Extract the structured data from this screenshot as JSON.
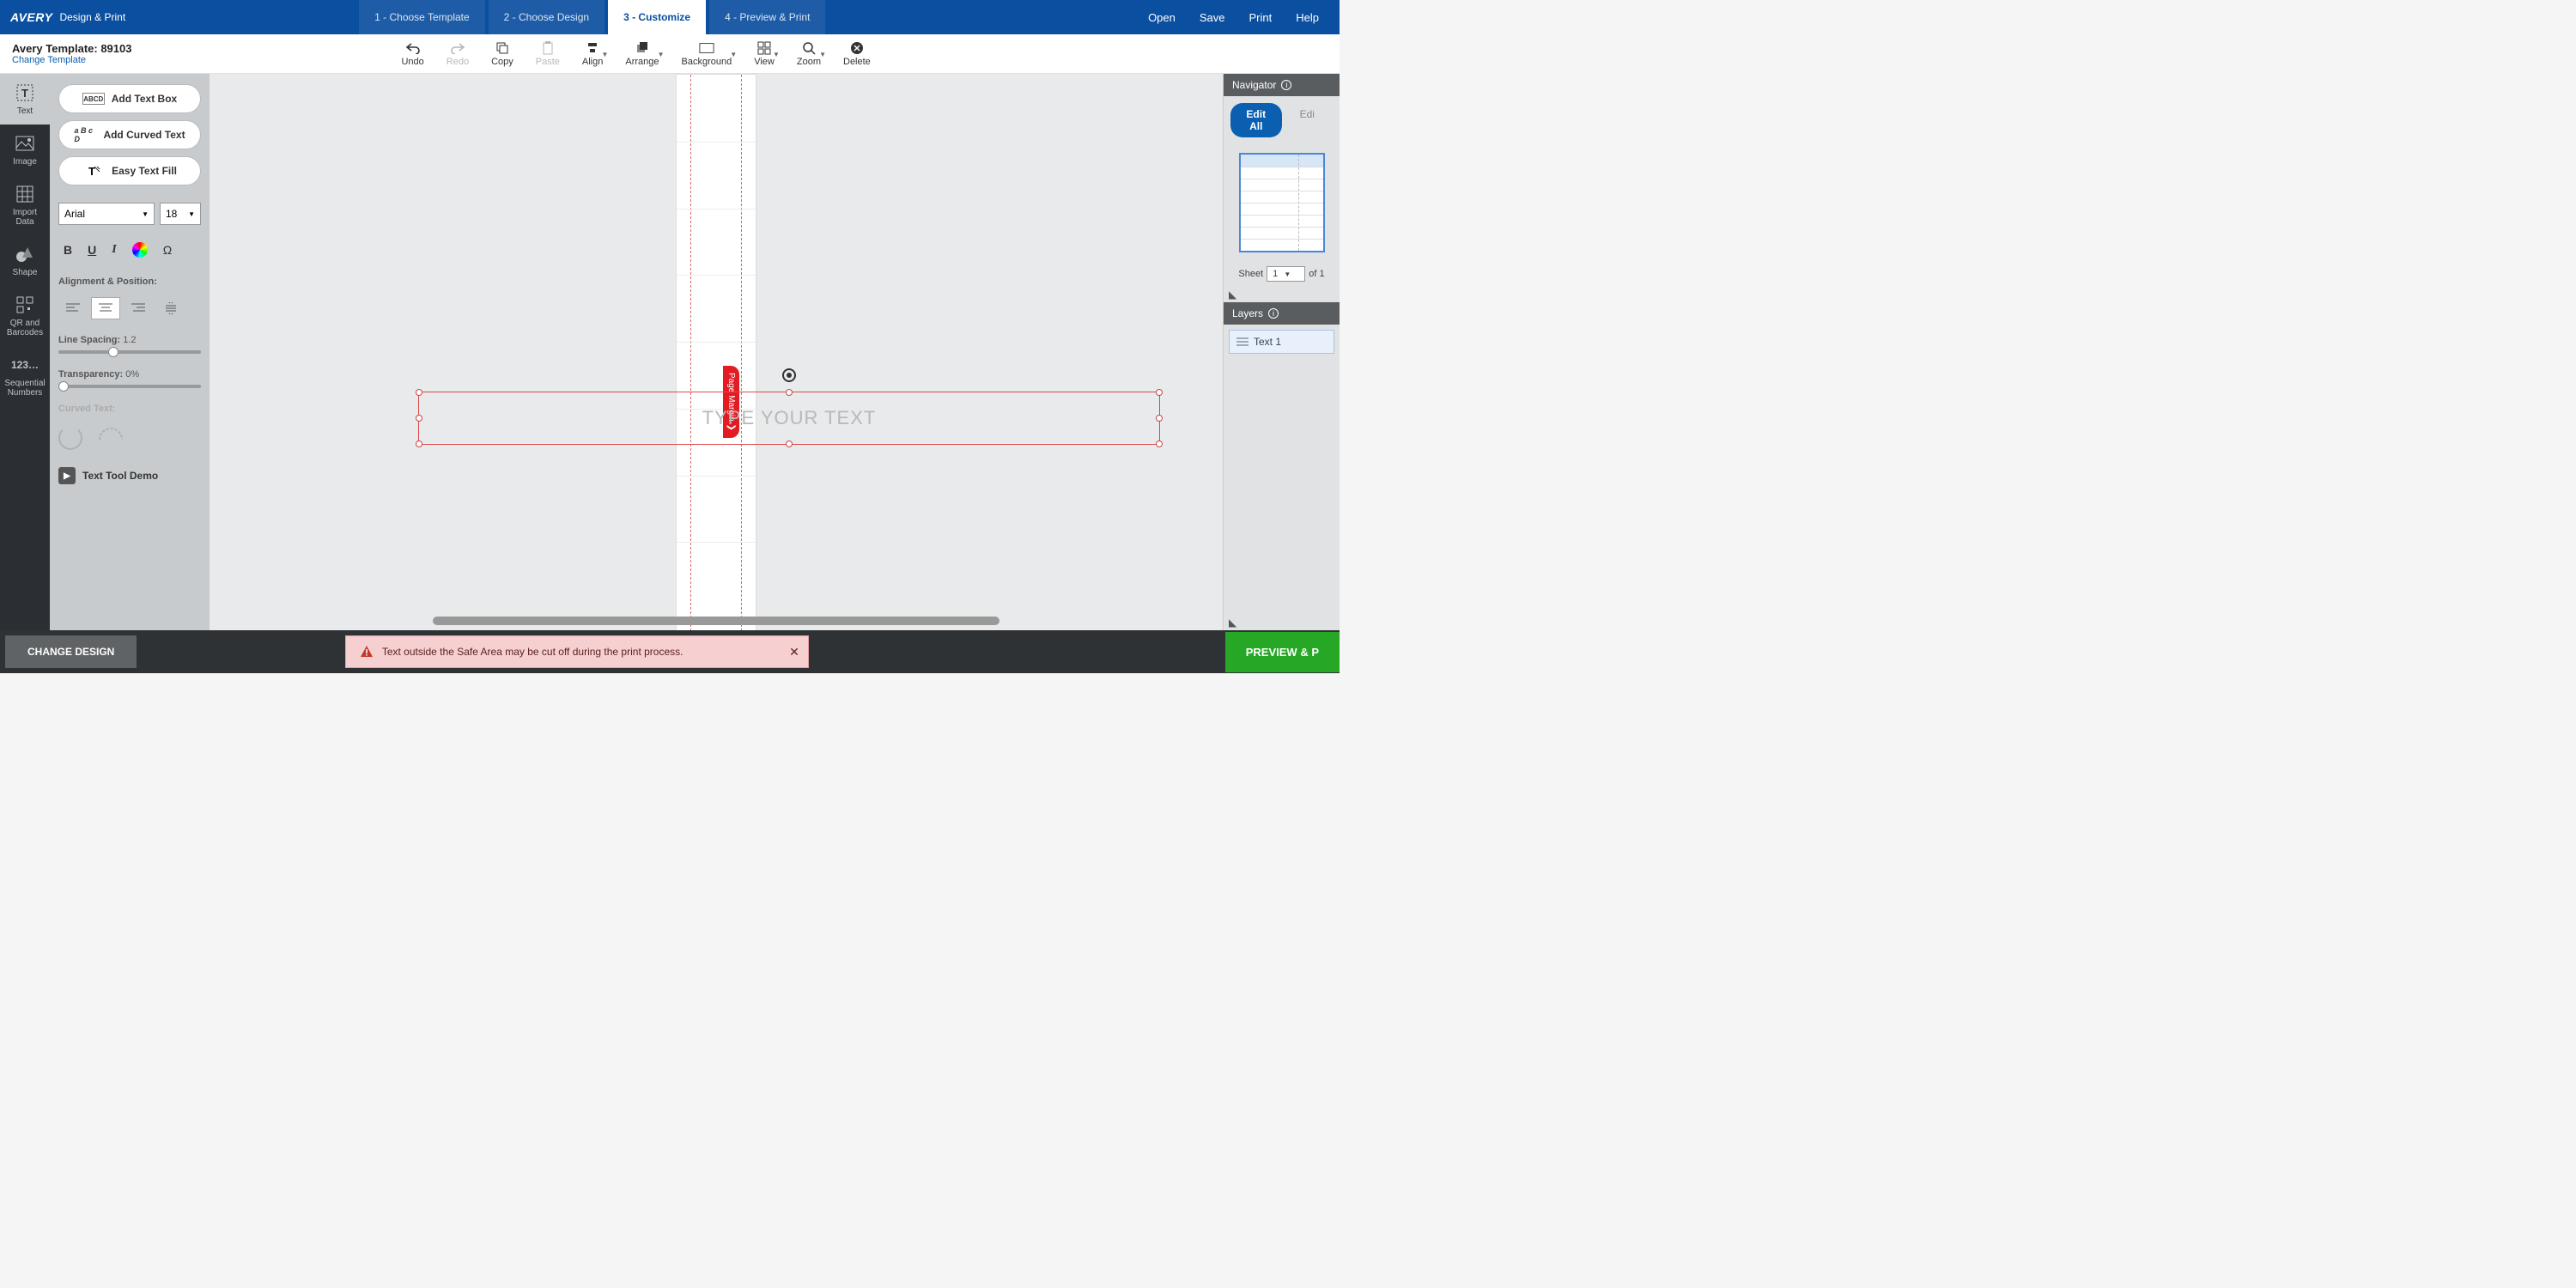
{
  "header": {
    "brand": "AVERY",
    "product": "Design & Print",
    "steps": [
      "1 - Choose Template",
      "2 - Choose Design",
      "3 - Customize",
      "4 - Preview & Print"
    ],
    "active_step": 2,
    "links": {
      "open": "Open",
      "save": "Save",
      "print": "Print",
      "help": "Help"
    }
  },
  "template": {
    "label": "Avery Template: 89103",
    "change": "Change Template"
  },
  "toolbar": {
    "undo": "Undo",
    "redo": "Redo",
    "copy": "Copy",
    "paste": "Paste",
    "align": "Align",
    "arrange": "Arrange",
    "background": "Background",
    "view": "View",
    "zoom": "Zoom",
    "delete": "Delete"
  },
  "rail": {
    "text": "Text",
    "image": "Image",
    "import": "Import Data",
    "shape": "Shape",
    "qr": "QR and Barcodes",
    "seq": "Sequential Numbers",
    "seq_icon_text": "123…"
  },
  "left_panel": {
    "add_text_box": "Add Text Box",
    "add_curved": "Add Curved Text",
    "easy_fill": "Easy Text Fill",
    "font_name": "Arial",
    "font_size": "18",
    "omega": "Ω",
    "abcd_icon": "ABCD",
    "curved_icon": "a B c D",
    "alignment_label": "Alignment & Position:",
    "line_spacing_label": "Line Spacing:",
    "line_spacing_value": "1.2",
    "transparency_label": "Transparency:",
    "transparency_value": "0%",
    "curved_label": "Curved Text:",
    "demo": "Text Tool Demo"
  },
  "canvas": {
    "placeholder": "TYPE YOUR TEXT",
    "margin_tag": "Page Margin ❯"
  },
  "navigator": {
    "title": "Navigator",
    "edit_all": "Edit All",
    "edit_one": "Edi",
    "sheet_label": "Sheet",
    "sheet_value": "1",
    "sheet_of": "of 1"
  },
  "layers": {
    "title": "Layers",
    "items": [
      "Text 1"
    ]
  },
  "footer": {
    "change_design": "CHANGE DESIGN",
    "warning": "Text outside the Safe Area may be cut off during the print process.",
    "preview": "PREVIEW & P"
  }
}
